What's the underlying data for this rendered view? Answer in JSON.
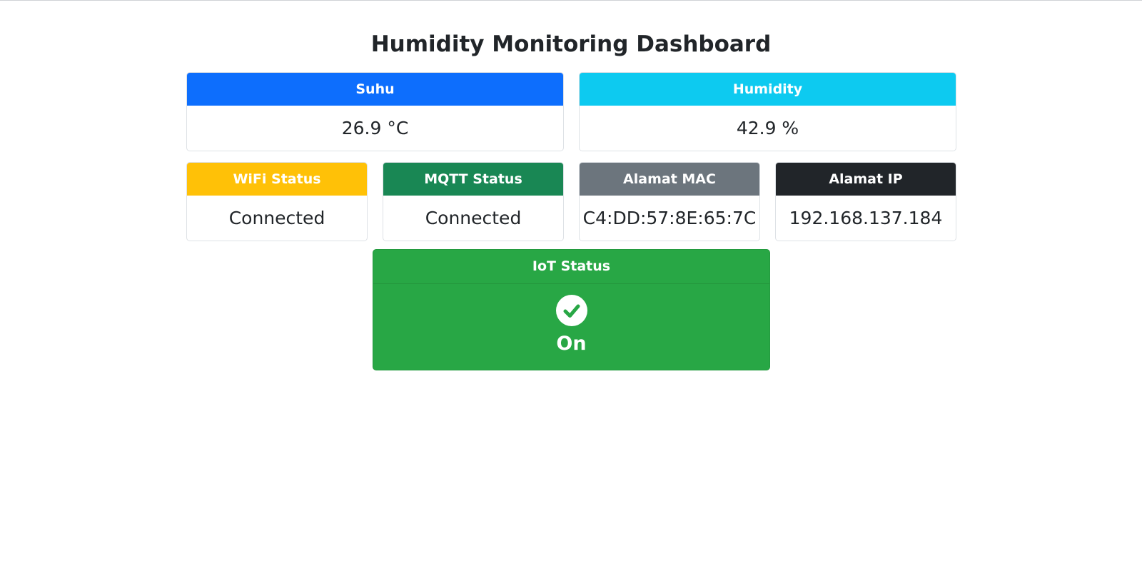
{
  "page": {
    "title": "Humidity Monitoring Dashboard"
  },
  "cards": {
    "suhu": {
      "label": "Suhu",
      "value": "26.9 °C",
      "color": "#0d6efd"
    },
    "humidity": {
      "label": "Humidity",
      "value": "42.9 %",
      "color": "#0dcaf0"
    },
    "wifi": {
      "label": "WiFi Status",
      "value": "Connected",
      "color": "#ffc107"
    },
    "mqtt": {
      "label": "MQTT Status",
      "value": "Connected",
      "color": "#198754"
    },
    "mac": {
      "label": "Alamat MAC",
      "value": "C4:DD:57:8E:65:7C",
      "color": "#6c757d"
    },
    "ip": {
      "label": "Alamat IP",
      "value": "192.168.137.184",
      "color": "#212529"
    }
  },
  "iot": {
    "label": "IoT Status",
    "value": "On",
    "icon": "check-circle-icon",
    "color": "#28a745"
  }
}
